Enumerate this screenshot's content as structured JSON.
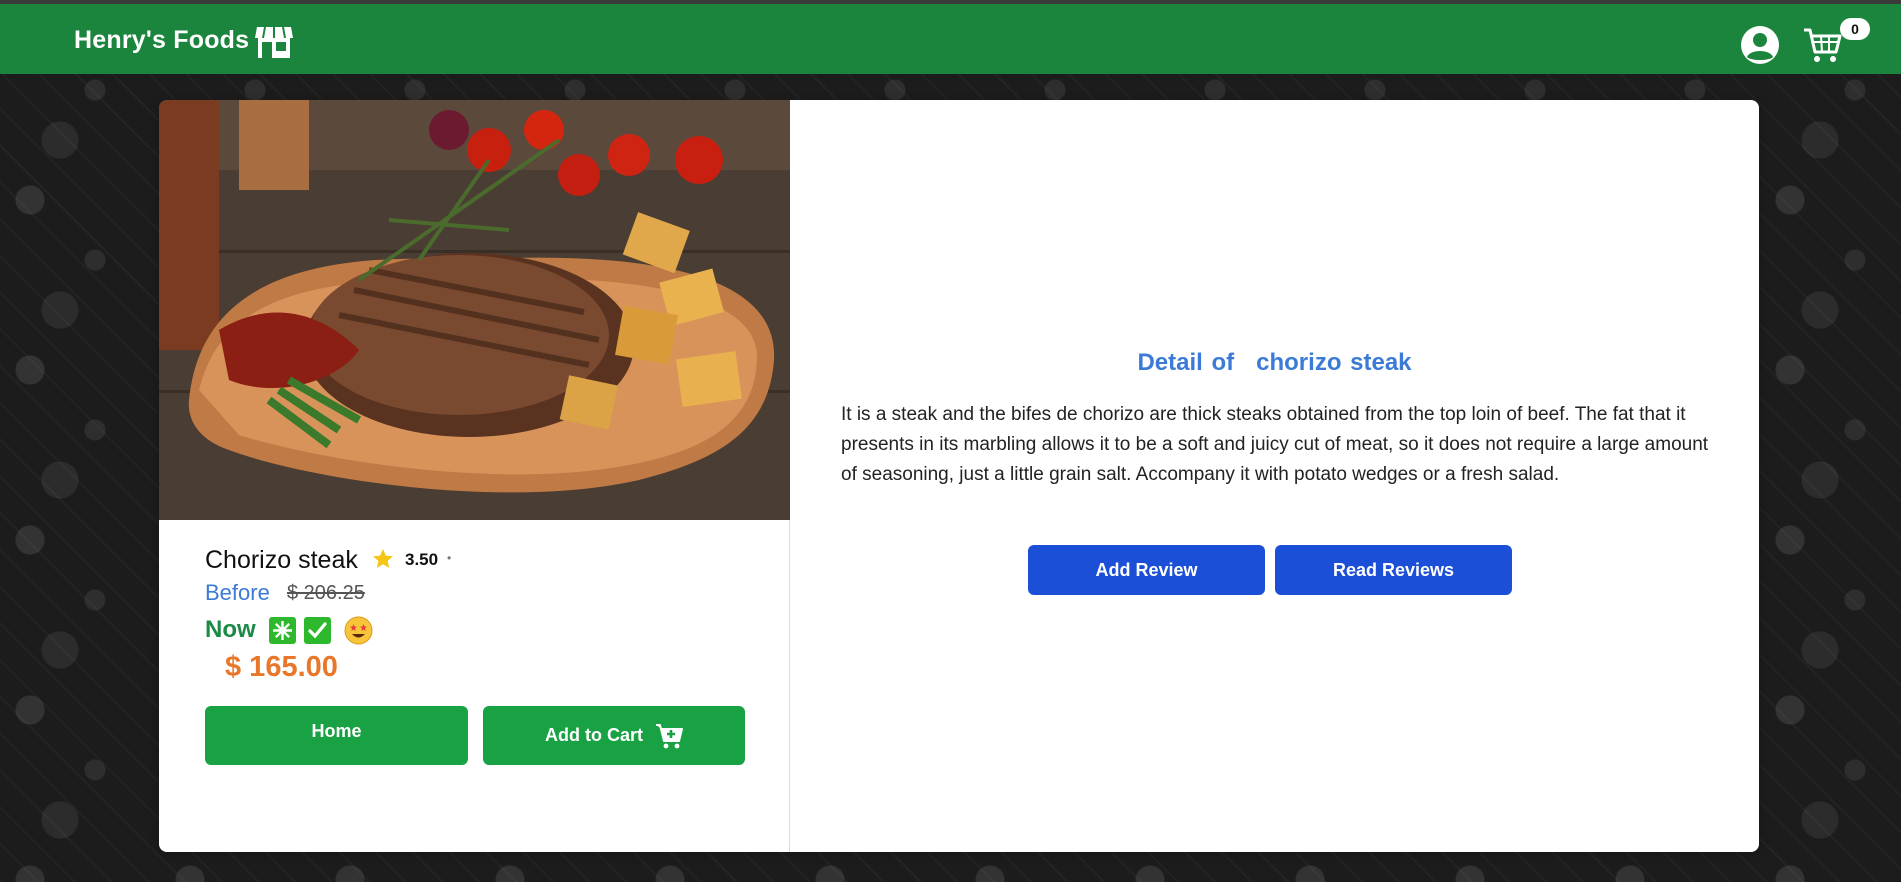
{
  "header": {
    "brand": "Henry's Foods",
    "cart_count": "0",
    "icons": [
      "store-icon",
      "user-icon",
      "cart-icon"
    ],
    "bar_color": "#1b853d"
  },
  "product": {
    "name": "Chorizo steak",
    "rating": "3.50",
    "rating_separator": "•",
    "before_label": "Before",
    "old_price": "$ 206.25",
    "now_label": "Now",
    "new_price": "$ 165.00",
    "badges": [
      "sparkle-icon",
      "check-icon",
      "star-struck-face-icon"
    ],
    "image": "grilled chorizo steak on wooden board with tomatoes, potatoes, peppers and green beans"
  },
  "buttons": {
    "home": "Home",
    "add_to_cart": "Add to Cart",
    "add_review": "Add Review",
    "read_reviews": "Read Reviews"
  },
  "detail": {
    "title_prefix": "Detail of",
    "title_name": "chorizo steak",
    "description": "It is a steak and the bifes de chorizo are thick steaks obtained from the top loin of beef. The fat that it presents in its marbling allows it to be a soft and juicy cut of meat, so it does not require a large amount of seasoning, just a little grain salt. Accompany it with potato wedges or a fresh salad."
  },
  "colors": {
    "primary_green": "#18a244",
    "accent_blue": "#1c4fd7",
    "link_blue": "#3b7bd6",
    "price_orange": "#e8772a",
    "now_green": "#1a8a44"
  }
}
